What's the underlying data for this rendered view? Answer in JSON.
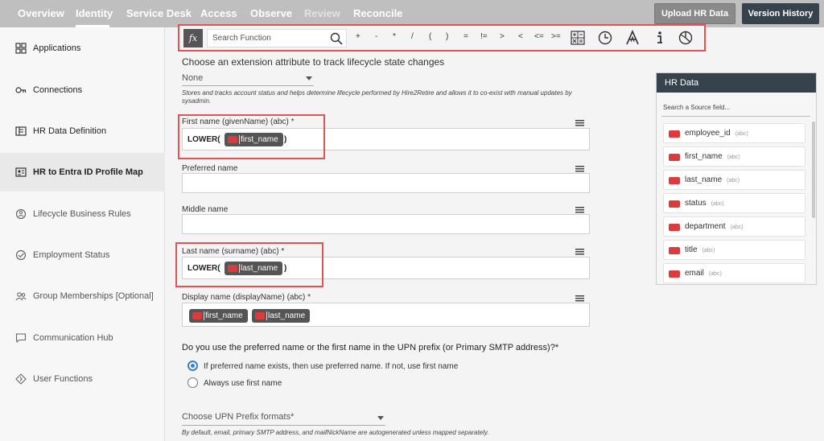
{
  "topnav": {
    "tabs": [
      {
        "label": "Overview"
      },
      {
        "label": "Identity"
      },
      {
        "label": "Service Desk"
      },
      {
        "label": "Access"
      },
      {
        "label": "Observe"
      },
      {
        "label": "Review"
      },
      {
        "label": "Reconcile"
      }
    ],
    "upload_label": "Upload HR Data",
    "version_label": "Version History"
  },
  "sidebar": {
    "items": [
      {
        "label": "Applications",
        "icon": "grid-icon"
      },
      {
        "label": "Connections",
        "icon": "plug-icon"
      },
      {
        "label": "HR Data Definition",
        "icon": "id-card-icon"
      },
      {
        "label": "HR to Entra ID Profile Map",
        "icon": "profile-card-icon"
      },
      {
        "label": "Lifecycle Business Rules",
        "icon": "lifecycle-icon"
      },
      {
        "label": "Employment Status",
        "icon": "check-circle-icon"
      },
      {
        "label": "Group Memberships [Optional]",
        "icon": "group-icon"
      },
      {
        "label": "Communication Hub",
        "icon": "chat-icon"
      },
      {
        "label": "User Functions",
        "icon": "function-icon"
      }
    ]
  },
  "toolbar": {
    "fx": "fx",
    "search_placeholder": "Search Function",
    "operators": [
      "+",
      "-",
      "*",
      "/",
      "(",
      ")",
      "=",
      "!=",
      ">",
      "<",
      "<=",
      ">="
    ]
  },
  "main": {
    "title": "Choose an extension attribute to track lifecycle state changes",
    "extension_value": "None",
    "extension_help": "Stores and tracks account status and helps determine lifecycle performed by Hire2Retire and allows it to co-exist with manual updates by sysadmin.",
    "fields": {
      "first_name": {
        "label": "First name (givenName) (abc) *",
        "fn": "LOWER(",
        "chip": "first_name",
        "close": ")"
      },
      "preferred_name": {
        "label": "Preferred name"
      },
      "middle_name": {
        "label": "Middle name"
      },
      "last_name": {
        "label": "Last name (surname) (abc) *",
        "fn": "LOWER(",
        "chip": "last_name",
        "close": ")"
      },
      "display_name": {
        "label": "Display name (displayName) (abc) *",
        "chip1": "first_name",
        "chip2": "last_name"
      }
    },
    "upn_question": "Do you use the preferred name or the first name in the UPN prefix (or Primary SMTP address)?*",
    "radio_preferred": "If preferred name exists, then use preferred name. If not, use first name",
    "radio_first": "Always use first name",
    "upn_format_placeholder": "Choose UPN Prefix formats*",
    "upn_help": "By default, email, primary SMTP address, and mailNickName are autogenerated unless mapped separately."
  },
  "hr_panel": {
    "title": "HR Data",
    "search_placeholder": "Search a Source field...",
    "fields": [
      {
        "name": "employee_id",
        "type": "(abc)"
      },
      {
        "name": "first_name",
        "type": "(abc)"
      },
      {
        "name": "last_name",
        "type": "(abc)"
      },
      {
        "name": "status",
        "type": "(abc)"
      },
      {
        "name": "department",
        "type": "(abc)"
      },
      {
        "name": "title",
        "type": "(abc)"
      },
      {
        "name": "email",
        "type": "(abc)"
      }
    ]
  },
  "colors": {
    "accent": "#3b7fc4",
    "highlight": "#e05454",
    "header": "#36434d",
    "adp": "#d83c3c"
  }
}
